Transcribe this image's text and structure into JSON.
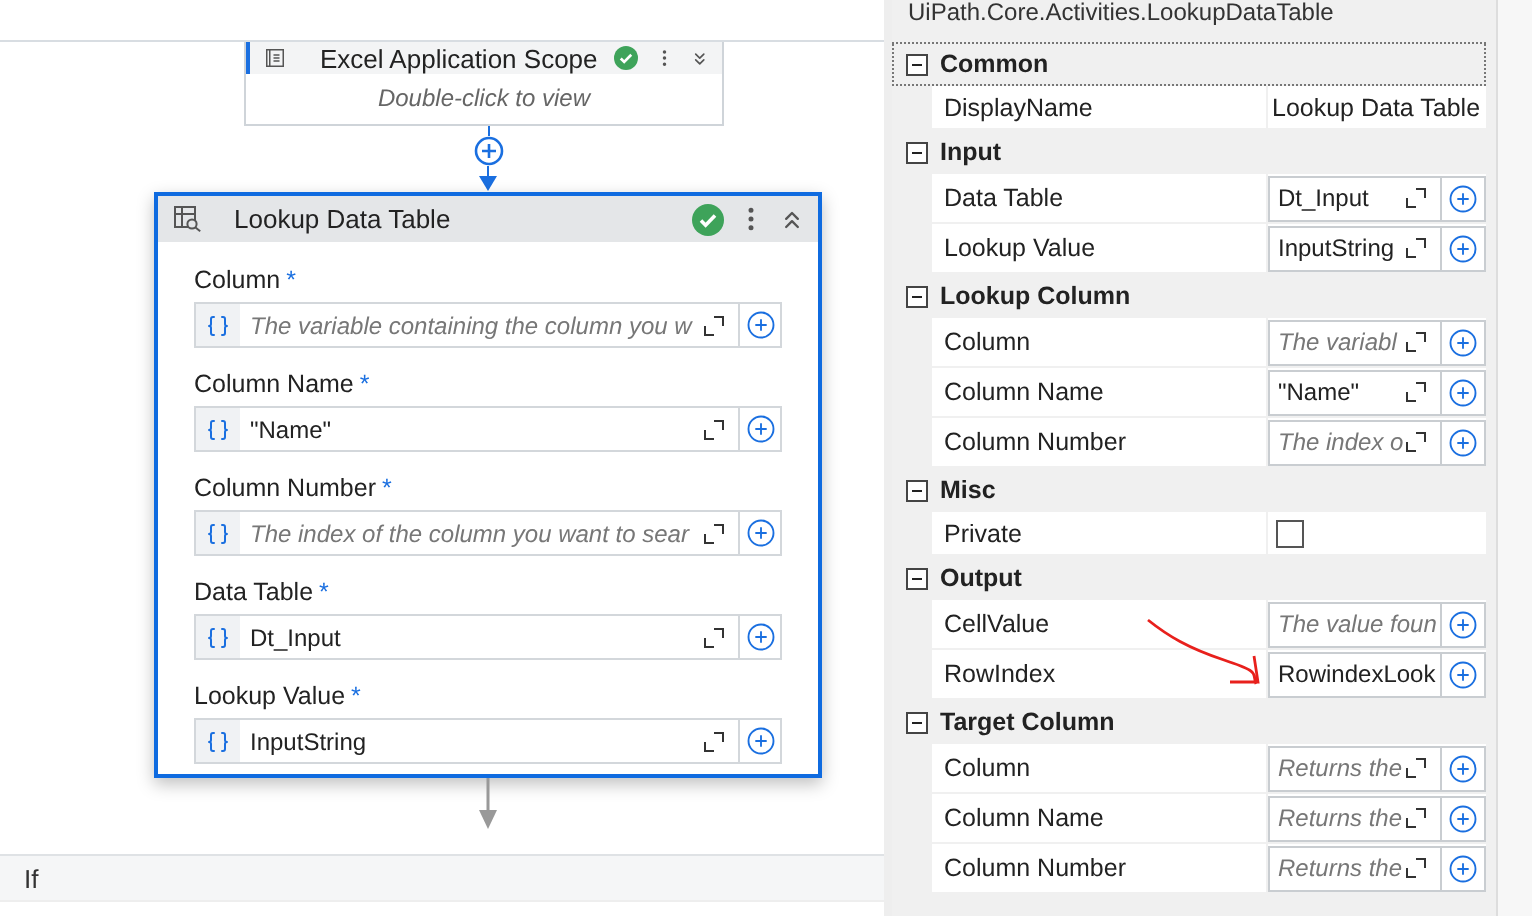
{
  "canvas": {
    "scope_activity": {
      "title": "Excel Application Scope",
      "hint": "Double-click to view",
      "valid": true,
      "expanded": false
    },
    "activity": {
      "title": "Lookup Data Table",
      "valid": true,
      "selected": true,
      "expanded": true,
      "fields": [
        {
          "label": "Column",
          "required_mark": "*",
          "placeholder": "The variable containing the column you w"
        },
        {
          "label": "Column Name",
          "required_mark": "*",
          "value": "\"Name\""
        },
        {
          "label": "Column Number",
          "required_mark": "*",
          "placeholder": "The index of the column you want to sear"
        },
        {
          "label": "Data Table",
          "required_mark": "*",
          "value": "Dt_Input"
        },
        {
          "label": "Lookup Value",
          "required_mark": "*",
          "value": "InputString"
        }
      ]
    },
    "next_activity": {
      "title": "If"
    }
  },
  "properties": {
    "title": "UiPath.Core.Activities.LookupDataTable",
    "categories": [
      {
        "name": "Common",
        "expanded": true,
        "focused": true,
        "properties": [
          {
            "name": "DisplayName",
            "kind": "text",
            "value": "Lookup Data Table"
          }
        ]
      },
      {
        "name": "Input",
        "expanded": true,
        "focused": false,
        "properties": [
          {
            "name": "Data Table",
            "kind": "argument",
            "expandable": true,
            "value": "Dt_Input"
          },
          {
            "name": "Lookup Value",
            "kind": "argument",
            "expandable": true,
            "value": "InputString"
          }
        ]
      },
      {
        "name": "Lookup Column",
        "expanded": true,
        "focused": false,
        "properties": [
          {
            "name": "Column",
            "kind": "argument",
            "expandable": true,
            "placeholder": "The variabl"
          },
          {
            "name": "Column Name",
            "kind": "argument",
            "expandable": true,
            "value": "\"Name\""
          },
          {
            "name": "Column Number",
            "kind": "argument",
            "expandable": true,
            "placeholder": "The index o"
          }
        ]
      },
      {
        "name": "Misc",
        "expanded": true,
        "focused": false,
        "properties": [
          {
            "name": "Private",
            "kind": "checkbox",
            "checked": false
          }
        ]
      },
      {
        "name": "Output",
        "expanded": true,
        "focused": false,
        "properties": [
          {
            "name": "CellValue",
            "kind": "argument",
            "expandable": false,
            "placeholder": "The value foun"
          },
          {
            "name": "RowIndex",
            "kind": "argument",
            "expandable": false,
            "value": "RowindexLook"
          }
        ]
      },
      {
        "name": "Target Column",
        "expanded": true,
        "focused": false,
        "properties": [
          {
            "name": "Column",
            "kind": "argument",
            "expandable": true,
            "placeholder": "Returns the"
          },
          {
            "name": "Column Name",
            "kind": "argument",
            "expandable": true,
            "placeholder": "Returns the"
          },
          {
            "name": "Column Number",
            "kind": "argument",
            "expandable": true,
            "placeholder": "Returns the"
          }
        ]
      }
    ]
  }
}
